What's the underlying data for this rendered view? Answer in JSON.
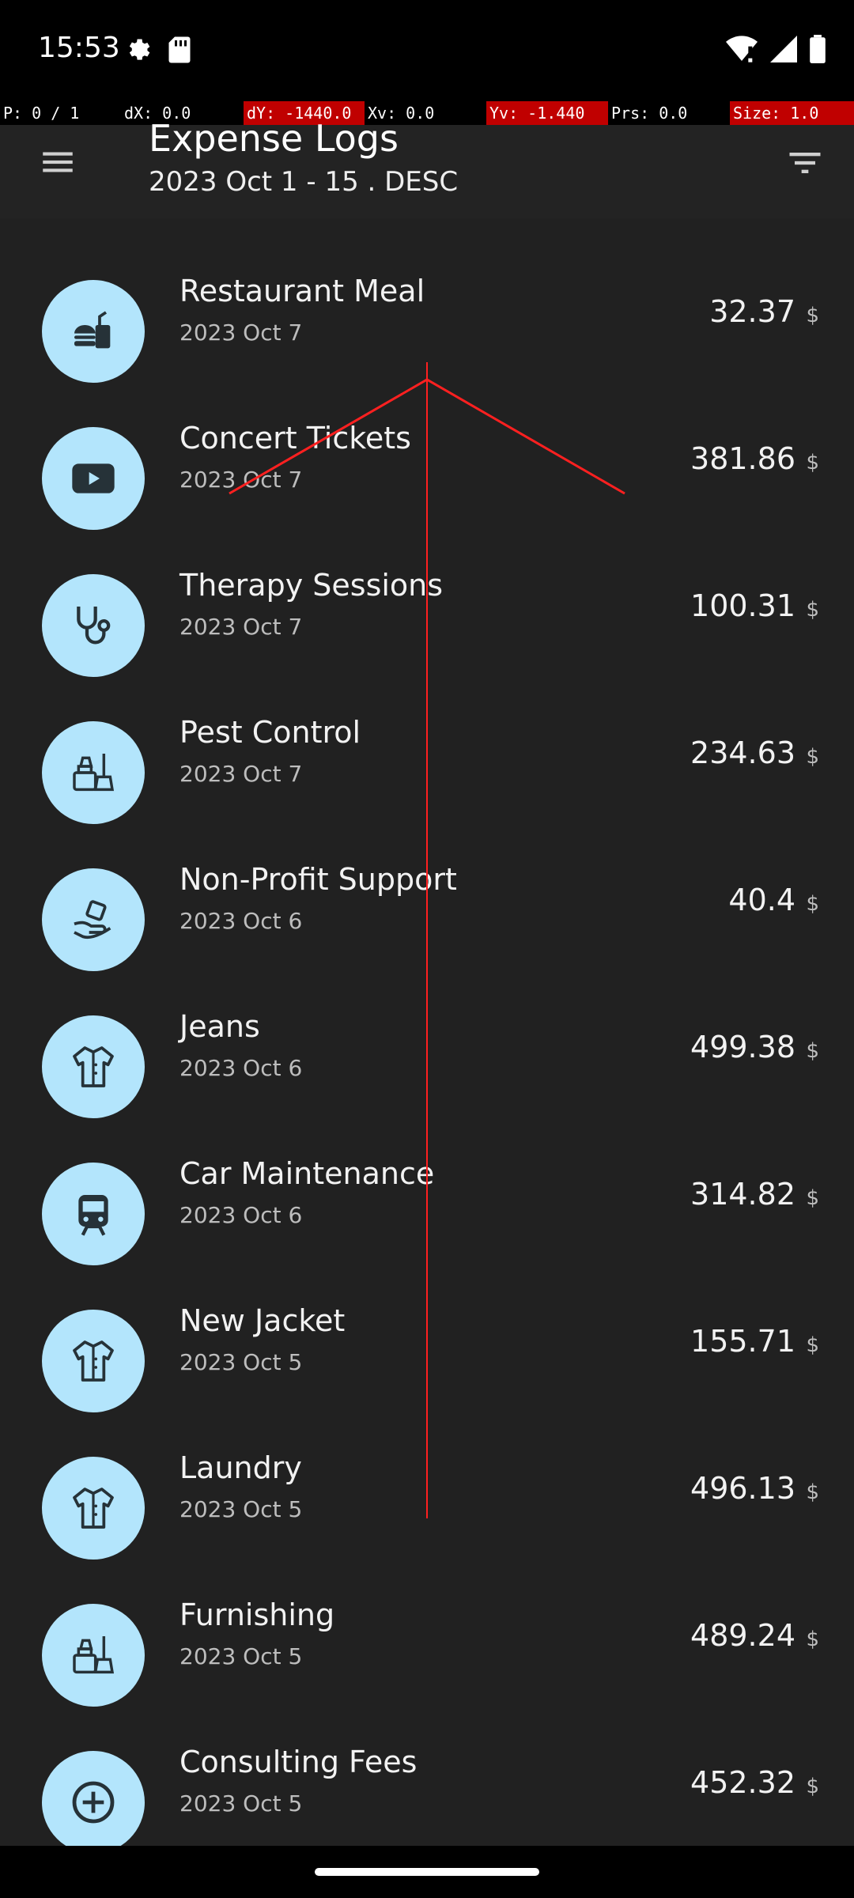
{
  "status_bar": {
    "time": "15:53",
    "left_icons": [
      "settings-icon",
      "sd-card-icon"
    ],
    "right_icons": [
      "wifi-icon",
      "signal-icon",
      "battery-icon"
    ]
  },
  "debug_bar": {
    "segments": [
      "P: 0 / 1",
      "dX: 0.0",
      "dY: -1440.0",
      "Xv: 0.0",
      "Yv: -1.440",
      "Prs: 0.0",
      "Size: 1.0"
    ]
  },
  "app_bar": {
    "title": "Expense Logs",
    "subtitle": "2023 Oct 1 - 15 . DESC",
    "menu_icon": "hamburger-menu-icon",
    "filter_icon": "filter-icon"
  },
  "expenses": [
    {
      "name": "Restaurant Meal",
      "date": "2023 Oct 7",
      "amount": "32.37",
      "currency": "$",
      "icon": "fast-food-icon"
    },
    {
      "name": "Concert Tickets",
      "date": "2023 Oct 7",
      "amount": "381.86",
      "currency": "$",
      "icon": "video-play-icon"
    },
    {
      "name": "Therapy Sessions",
      "date": "2023 Oct 7",
      "amount": "100.31",
      "currency": "$",
      "icon": "stethoscope-icon"
    },
    {
      "name": "Pest Control",
      "date": "2023 Oct 7",
      "amount": "234.63",
      "currency": "$",
      "icon": "cleaning-supplies-icon"
    },
    {
      "name": "Non-Profit Support",
      "date": "2023 Oct 6",
      "amount": "40.4",
      "currency": "$",
      "icon": "donation-hand-icon"
    },
    {
      "name": "Jeans",
      "date": "2023 Oct 6",
      "amount": "499.38",
      "currency": "$",
      "icon": "shirt-icon"
    },
    {
      "name": "Car Maintenance",
      "date": "2023 Oct 6",
      "amount": "314.82",
      "currency": "$",
      "icon": "train-icon"
    },
    {
      "name": "New Jacket",
      "date": "2023 Oct 5",
      "amount": "155.71",
      "currency": "$",
      "icon": "shirt-icon"
    },
    {
      "name": "Laundry",
      "date": "2023 Oct 5",
      "amount": "496.13",
      "currency": "$",
      "icon": "shirt-icon"
    },
    {
      "name": "Furnishing",
      "date": "2023 Oct 5",
      "amount": "489.24",
      "currency": "$",
      "icon": "cleaning-supplies-icon"
    },
    {
      "name": "Consulting Fees",
      "date": "2023 Oct 5",
      "amount": "452.32",
      "currency": "$",
      "icon": "add-circle-icon"
    }
  ],
  "colors": {
    "icon_background": "#b3e5fc",
    "icon_foreground": "#263238",
    "gesture_overlay": "#ff0000"
  }
}
